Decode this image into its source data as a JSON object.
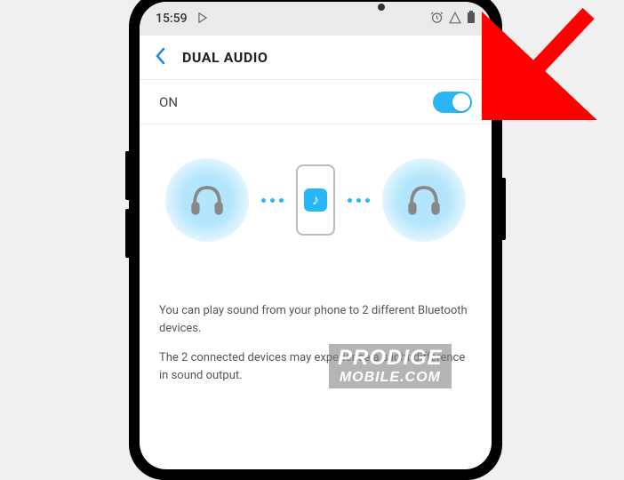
{
  "status": {
    "time": "15:59",
    "play_icon": "play-store-icon",
    "alarm_icon": "alarm-icon",
    "signal_icon": "signal-icon",
    "battery_icon": "battery-icon"
  },
  "header": {
    "back_icon": "chevron-left-icon",
    "title": "DUAL AUDIO"
  },
  "toggle": {
    "label": "ON",
    "state": "on"
  },
  "description": {
    "line1": "You can play sound from your phone to 2 different Bluetooth devices.",
    "line2": "The 2 connected devices may experience a slight difference in sound output."
  },
  "watermark": {
    "line1": "PRODIGE",
    "line2": "MOBILE.COM"
  }
}
